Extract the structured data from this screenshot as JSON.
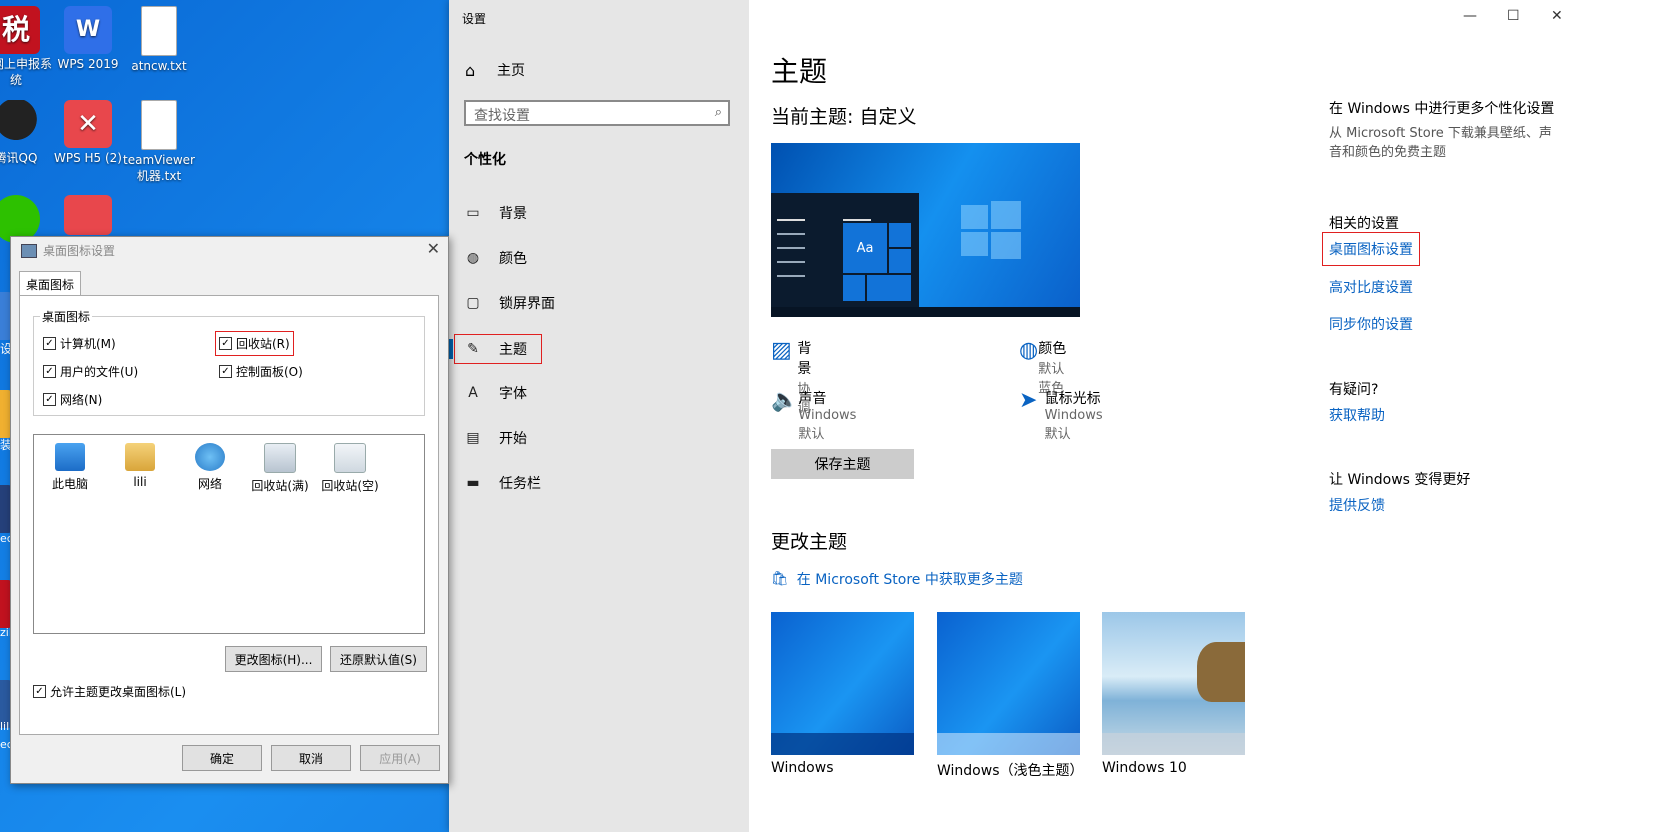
{
  "desktop": {
    "icons": [
      {
        "label": "川网上申报系统",
        "glyph": "税"
      },
      {
        "label": "WPS 2019",
        "glyph": "W"
      },
      {
        "label": "atncw.txt",
        "glyph": ""
      },
      {
        "label": "腾讯QQ",
        "glyph": ""
      },
      {
        "label": "WPS H5 (2)",
        "glyph": "✕"
      },
      {
        "label": "teamViewer机器.txt",
        "glyph": ""
      }
    ],
    "partial_left_texts": [
      "设",
      "装",
      "ec",
      "zil",
      "lili",
      "ec"
    ]
  },
  "settings": {
    "window_title": "设置",
    "home_label": "主页",
    "search_placeholder": "查找设置",
    "section": "个性化",
    "nav_items": [
      {
        "label": "背景",
        "icon": "image-icon",
        "glyph": "▭"
      },
      {
        "label": "颜色",
        "icon": "palette-icon",
        "glyph": "◍"
      },
      {
        "label": "锁屏界面",
        "icon": "lockscreen-icon",
        "glyph": "▢"
      },
      {
        "label": "主题",
        "icon": "theme-icon",
        "glyph": "✎"
      },
      {
        "label": "字体",
        "icon": "font-icon",
        "glyph": "A"
      },
      {
        "label": "开始",
        "icon": "start-icon",
        "glyph": "▤"
      },
      {
        "label": "任务栏",
        "icon": "taskbar-icon",
        "glyph": "▬"
      }
    ],
    "main": {
      "title": "主题",
      "current_theme": "当前主题: 自定义",
      "preview_tile_text": "Aa",
      "props": [
        {
          "title": "背景",
          "value": "协调",
          "icon": "image-icon",
          "glyph": "▨"
        },
        {
          "title": "颜色",
          "value": "默认蓝色",
          "icon": "palette-icon",
          "glyph": "◍"
        },
        {
          "title": "声音",
          "value": "Windows 默认",
          "icon": "speaker-icon",
          "glyph": "🔈"
        },
        {
          "title": "鼠标光标",
          "value": "Windows 默认",
          "icon": "cursor-icon",
          "glyph": "➤"
        }
      ],
      "save_button": "保存主题",
      "change_theme_heading": "更改主题",
      "store_link": "在 Microsoft Store 中获取更多主题",
      "themes": [
        "Windows",
        "Windows（浅色主题）",
        "Windows 10"
      ]
    },
    "side": {
      "more_title": "在 Windows 中进行更多个性化设置",
      "more_desc": "从 Microsoft Store 下载兼具壁纸、声音和颜色的免费主题",
      "related_title": "相关的设置",
      "links": [
        "桌面图标设置",
        "高对比度设置",
        "同步你的设置"
      ],
      "question_title": "有疑问?",
      "help_link": "获取帮助",
      "improve_title": "让 Windows 变得更好",
      "feedback_link": "提供反馈"
    },
    "controls": {
      "minimize": "—",
      "maximize": "☐",
      "close": "✕"
    }
  },
  "dialog": {
    "title": "桌面图标设置",
    "tab": "桌面图标",
    "group_label": "桌面图标",
    "checkboxes": [
      {
        "label": "计算机(M)",
        "checked": true
      },
      {
        "label": "回收站(R)",
        "checked": true
      },
      {
        "label": "用户的文件(U)",
        "checked": true
      },
      {
        "label": "控制面板(O)",
        "checked": true
      },
      {
        "label": "网络(N)",
        "checked": true
      }
    ],
    "list_icons": [
      "此电脑",
      "lili",
      "网络",
      "回收站(满)",
      "回收站(空)"
    ],
    "change_icon_button": "更改图标(H)...",
    "restore_default_button": "还原默认值(S)",
    "allow_themes_label": "允许主题更改桌面图标(L)",
    "ok": "确定",
    "cancel": "取消",
    "apply": "应用(A)",
    "check_glyph": "✓"
  },
  "colors": {
    "accent": "#0063b1",
    "link": "#0a63c2",
    "highlight_box": "#e02020"
  }
}
